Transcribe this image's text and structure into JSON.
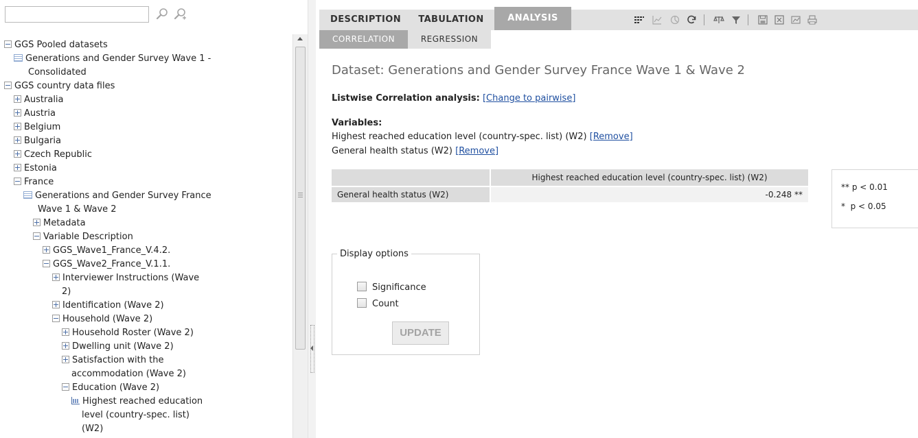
{
  "search": {
    "value": ""
  },
  "tree": {
    "items": [
      {
        "type": "minus",
        "label": "GGS Pooled datasets"
      },
      {
        "type": "dataset",
        "label": "Generations and Gender Survey Wave 1 -"
      },
      {
        "type": "cont",
        "label": "Consolidated"
      },
      {
        "type": "minus",
        "label": "GGS country data files"
      },
      {
        "type": "plus",
        "label": "Australia"
      },
      {
        "type": "plus",
        "label": "Austria"
      },
      {
        "type": "plus",
        "label": "Belgium"
      },
      {
        "type": "plus",
        "label": "Bulgaria"
      },
      {
        "type": "plus",
        "label": "Czech Republic"
      },
      {
        "type": "plus",
        "label": "Estonia"
      },
      {
        "type": "minus",
        "label": "France"
      },
      {
        "type": "dataset",
        "label": "Generations and Gender Survey France"
      },
      {
        "type": "cont",
        "label": "Wave 1 & Wave 2"
      },
      {
        "type": "plus",
        "label": "Metadata"
      },
      {
        "type": "minus",
        "label": "Variable Description"
      },
      {
        "type": "plus",
        "label": "GGS_Wave1_France_V.4.2."
      },
      {
        "type": "minus",
        "label": "GGS_Wave2_France_V.1.1."
      },
      {
        "type": "plus",
        "label": "Interviewer Instructions (Wave"
      },
      {
        "type": "cont",
        "label": "2)"
      },
      {
        "type": "plus",
        "label": "Identification (Wave 2)"
      },
      {
        "type": "minus",
        "label": "Household (Wave 2)"
      },
      {
        "type": "plus",
        "label": "Household Roster (Wave 2)"
      },
      {
        "type": "plus",
        "label": "Dwelling unit (Wave 2)"
      },
      {
        "type": "plus",
        "label": "Satisfaction with the"
      },
      {
        "type": "cont",
        "label": "accommodation (Wave 2)"
      },
      {
        "type": "minus",
        "label": "Education (Wave 2)"
      },
      {
        "type": "variable",
        "label": "Highest reached education"
      },
      {
        "type": "cont",
        "label": "level (country-spec. list)"
      },
      {
        "type": "cont",
        "label": "(W2)"
      }
    ]
  },
  "tabs": {
    "description": "DESCRIPTION",
    "tabulation": "TABULATION",
    "analysis": "ANALYSIS"
  },
  "subtabs": {
    "correlation": "CORRELATION",
    "regression": "REGRESSION"
  },
  "toolbar": {
    "icons": [
      "grid-icon",
      "chart-icon",
      "pie-icon",
      "refresh-icon",
      "scales-icon",
      "filter-icon",
      "save-icon",
      "export-icon",
      "graph-export-icon",
      "print-icon"
    ]
  },
  "main": {
    "dataset_title": "Dataset: Generations and Gender Survey France Wave 1 & Wave 2",
    "analysis_label": "Listwise Correlation analysis:",
    "change_link": "[Change to pairwise]",
    "variables_heading": "Variables:",
    "variables": [
      {
        "label": "Highest reached education level (country-spec. list) (W2)",
        "remove": "[Remove]"
      },
      {
        "label": "General health status (W2)",
        "remove": "[Remove]"
      }
    ],
    "table": {
      "column_header": "Highest reached education level (country-spec. list) (W2)",
      "row_label": "General health status (W2)",
      "value": "-0.248 **"
    },
    "legend": {
      "row1": "** p < 0.01",
      "row2": "*  p < 0.05"
    },
    "display_options": {
      "title": "Display options",
      "significance": "Significance",
      "count": "Count",
      "update": "UPDATE"
    }
  }
}
